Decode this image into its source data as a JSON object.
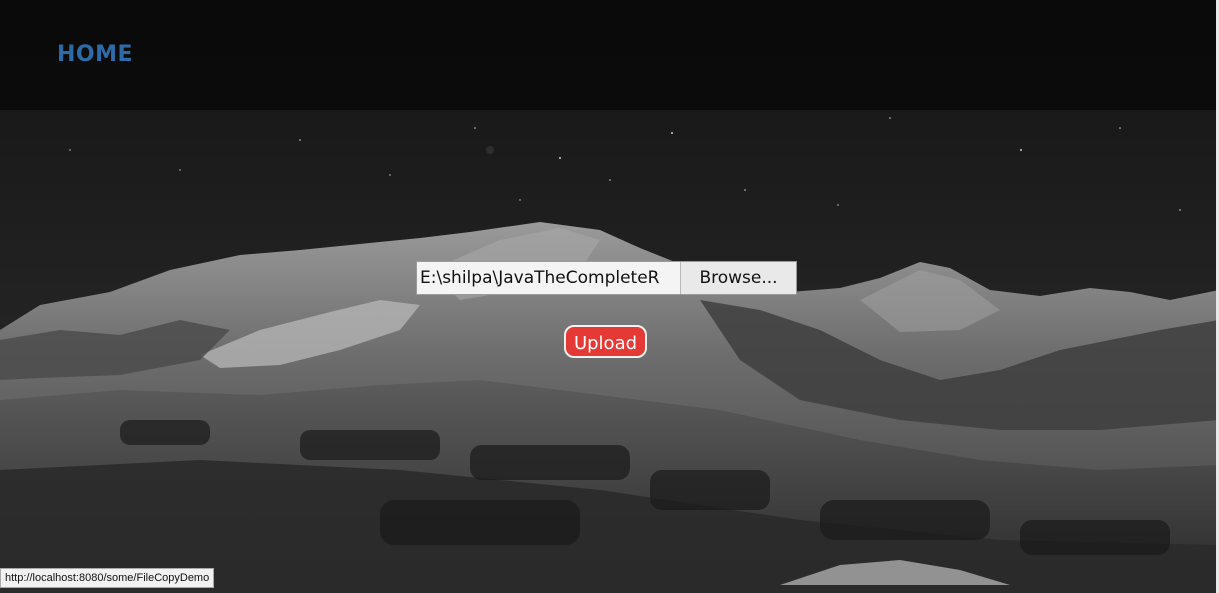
{
  "nav": {
    "home_label": "HOME"
  },
  "upload_form": {
    "file_path_value": "E:\\shilpa\\JavaTheCompleteR",
    "browse_label": "Browse...",
    "upload_label": "Upload"
  },
  "status_bar": {
    "url": "http://localhost:8080/some/FileCopyDemo"
  },
  "colors": {
    "nav_accent": "#2d6aa8",
    "upload_button": "#e53935",
    "topbar_bg": "#0a0a0a"
  },
  "icons": {
    "background": "night-mountain-landscape-image"
  }
}
